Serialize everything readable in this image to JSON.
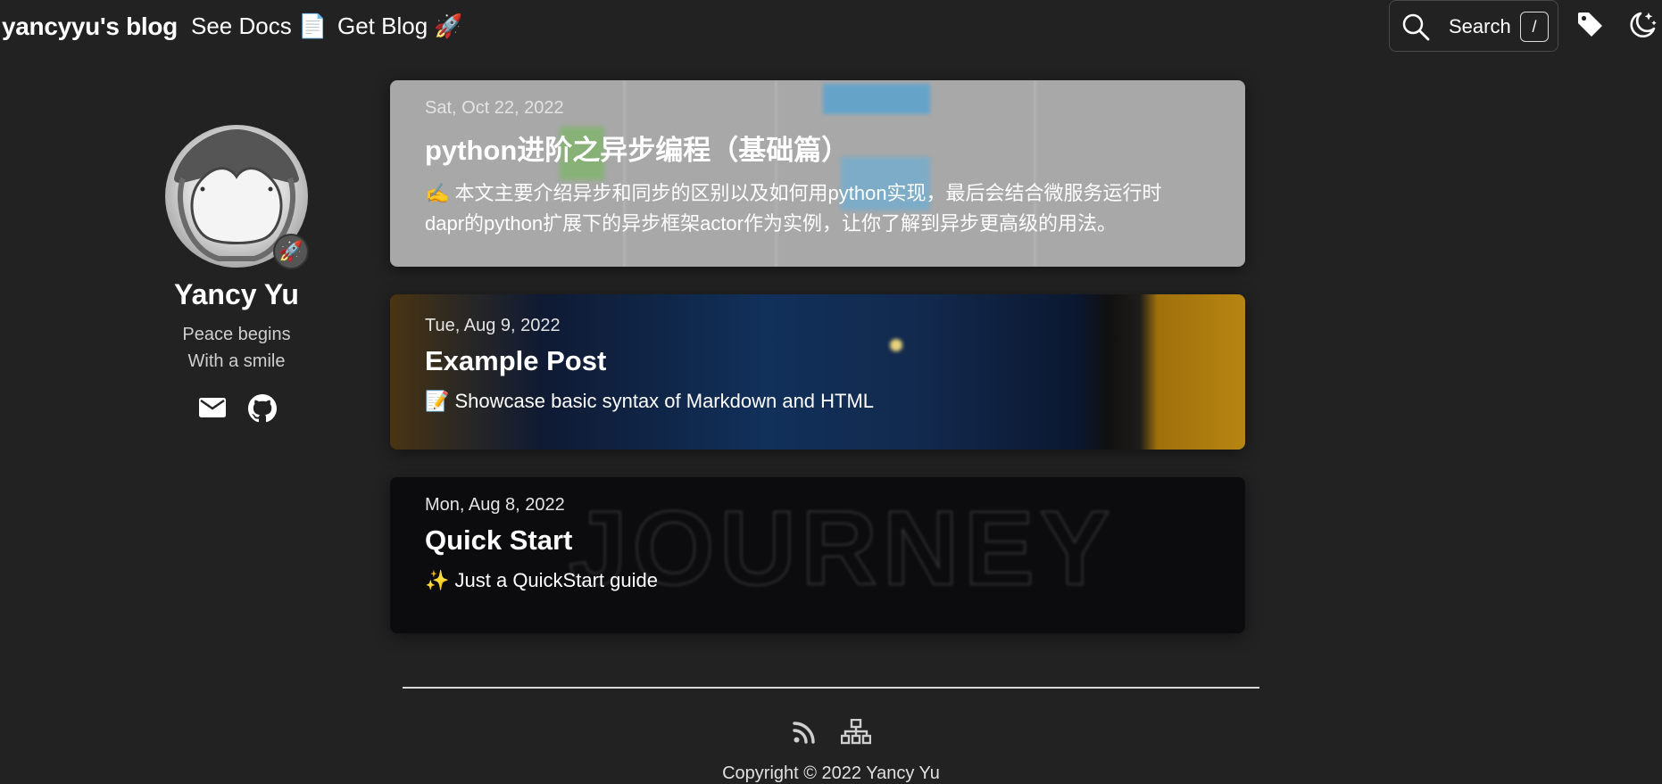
{
  "header": {
    "site_title": "yancyyu's blog",
    "nav": [
      {
        "label": "See Docs 📄"
      },
      {
        "label": "Get Blog 🚀"
      }
    ],
    "search": {
      "label": "Search",
      "shortcut": "/"
    },
    "icons": [
      "search-icon",
      "tag-icon",
      "theme-toggle-icon"
    ]
  },
  "profile": {
    "name": "Yancy Yu",
    "bio_line1": "Peace begins",
    "bio_line2": "With a smile",
    "badge": "🚀",
    "social": [
      "mail-icon",
      "github-icon"
    ]
  },
  "posts": [
    {
      "date": "Sat, Oct 22, 2022",
      "title": "python进阶之异步编程（基础篇）",
      "summary": "✍️ 本文主要介绍异步和同步的区别以及如何用python实现，最后会结合微服务运行时dapr的python扩展下的异步框架actor作为实例，让你了解到异步更高级的用法。"
    },
    {
      "date": "Tue, Aug 9, 2022",
      "title": "Example Post",
      "summary": "📝 Showcase basic syntax of Markdown and HTML"
    },
    {
      "date": "Mon, Aug 8, 2022",
      "title": "Quick Start",
      "summary": "✨ Just a QuickStart guide"
    }
  ],
  "footer": {
    "icons": [
      "rss-icon",
      "sitemap-icon"
    ],
    "copyright": "Copyright © 2022 Yancy Yu"
  },
  "colors": {
    "background": "#222222",
    "text": "#ffffff",
    "muted": "#cfcfcf"
  }
}
